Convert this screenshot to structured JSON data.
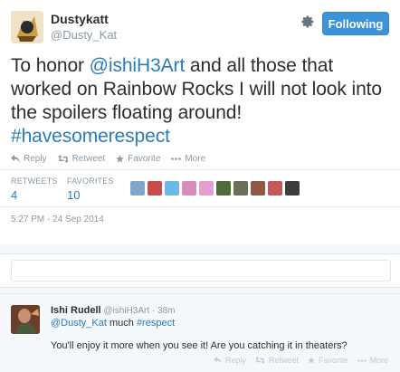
{
  "tweet": {
    "author_name": "Dustykatt",
    "author_handle": "@Dusty_Kat",
    "follow_label": "Following",
    "text_part1": "To honor ",
    "text_mention": "@ishiH3Art",
    "text_part2": " and all those that worked on Rainbow Rocks I will not look into the spoilers floating around! ",
    "text_hashtag": "#havesomerespect",
    "actions": {
      "reply": "Reply",
      "retweet": "Retweet",
      "favorite": "Favorite",
      "more": "More"
    },
    "stats": {
      "retweets_label": "RETWEETS",
      "retweets_value": "4",
      "favorites_label": "FAVORITES",
      "favorites_value": "10"
    },
    "timestamp": "5:27 PM - 24 Sep 2014"
  },
  "favoriter_colors": [
    "#7fa7c9",
    "#c94b4b",
    "#6db8e8",
    "#d98cc0",
    "#e3a0d6",
    "#4f6d3a",
    "#6a6f5a",
    "#8b5a40",
    "#c25a5a",
    "#3d3d3d"
  ],
  "reply": {
    "author_name": "Ishi Rudell",
    "author_handle": "@ishiH3Art",
    "separator": " · ",
    "time": "38m",
    "mention": "@Dusty_Kat",
    "middle": " much ",
    "hashtag": "#respect",
    "text2": "You'll enjoy it more when you see it! Are you catching it in theaters?",
    "actions": {
      "reply": "Reply",
      "retweet": "Retweet",
      "favorite": "Favorite",
      "more": "More"
    }
  },
  "colors": {
    "accent": "#3b94d9",
    "link": "#2b7bb9",
    "muted": "#8899a6"
  }
}
